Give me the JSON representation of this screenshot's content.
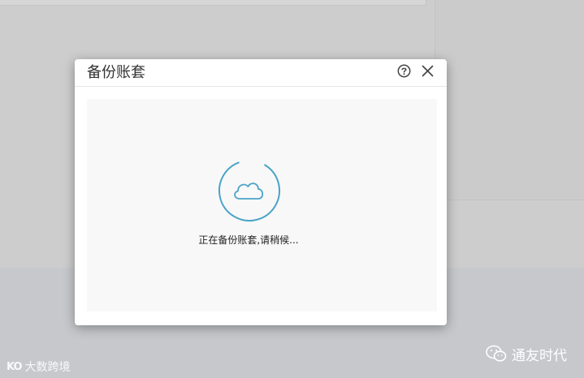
{
  "dialog": {
    "title": "备份账套",
    "help_icon": "help-circle-icon",
    "close_icon": "close-icon",
    "status_text": "正在备份账套,请稍候...",
    "spinner_icon": "cloud-icon",
    "accent_color": "#4aa3c8"
  },
  "watermarks": {
    "left_logo": "KO",
    "left_text": "大数跨境",
    "right_icon": "wechat-icon",
    "right_text": "通友时代"
  }
}
